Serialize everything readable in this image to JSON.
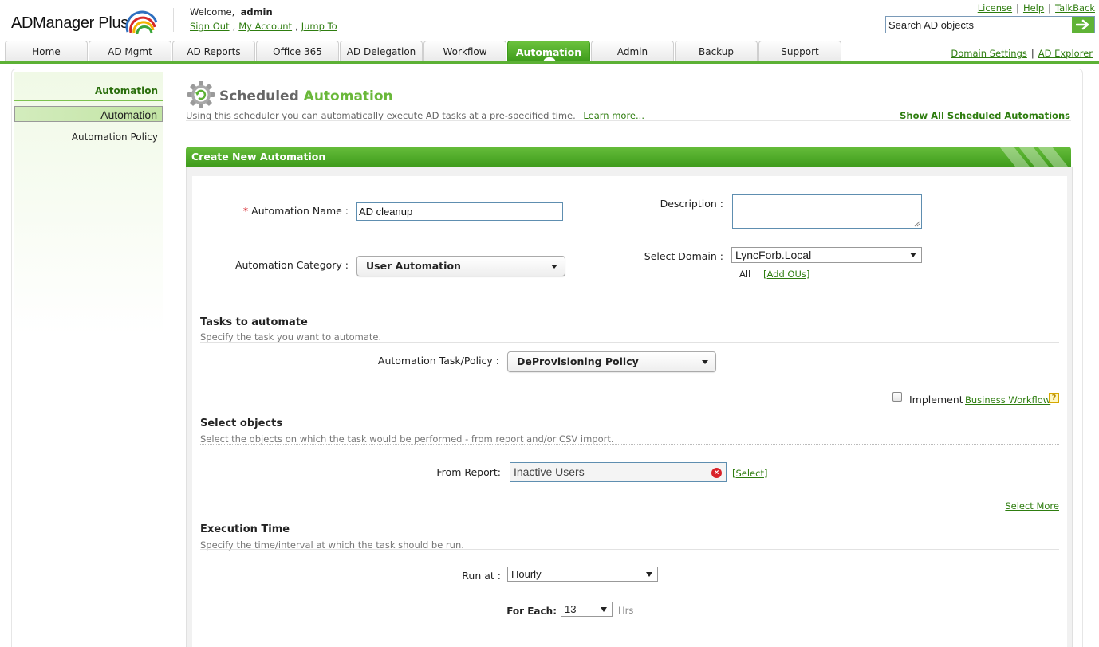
{
  "header": {
    "logo_text_bold": "ADManager",
    "logo_text_light": " Plus",
    "welcome_label": "Welcome,",
    "username": "admin",
    "user_links": [
      "Sign Out",
      "My Account",
      "Jump To"
    ],
    "top_links": [
      "License",
      "Help",
      "TalkBack"
    ],
    "search_placeholder": "Search AD objects"
  },
  "tabs": [
    {
      "label": "Home",
      "active": false
    },
    {
      "label": "AD Mgmt",
      "active": false
    },
    {
      "label": "AD Reports",
      "active": false
    },
    {
      "label": "Office 365",
      "active": false
    },
    {
      "label": "AD Delegation",
      "active": false
    },
    {
      "label": "Workflow",
      "active": false
    },
    {
      "label": "Automation",
      "active": true
    },
    {
      "label": "Admin",
      "active": false
    },
    {
      "label": "Backup",
      "active": false
    },
    {
      "label": "Support",
      "active": false
    }
  ],
  "right_links": [
    "Domain Settings",
    "AD Explorer"
  ],
  "sidebar": {
    "heading": "Automation",
    "items": [
      {
        "label": "Automation",
        "selected": true
      },
      {
        "label": "Automation Policy",
        "selected": false
      }
    ]
  },
  "page": {
    "title_gray": "Scheduled ",
    "title_green": "Automation",
    "subtitle": "Using this scheduler you can automatically execute AD tasks at a pre-specified time.",
    "learn_more": "Learn more...",
    "show_all": "Show All Scheduled Automations",
    "panel_title": "Create New Automation"
  },
  "form": {
    "required_mark": "*",
    "automation_name_label": "Automation Name :",
    "automation_name_value": "AD cleanup",
    "description_label": "Description :",
    "description_value": "",
    "category_label": "Automation Category :",
    "category_value": "User Automation",
    "domain_label": "Select Domain :",
    "domain_value": "LyncForb.Local",
    "ou_scope": "All",
    "add_ous": "[Add OUs]"
  },
  "tasks": {
    "title": "Tasks to automate",
    "desc": "Specify the task you want to automate.",
    "task_label": "Automation Task/Policy :",
    "task_value": "DeProvisioning Policy",
    "implement_label": "Implement",
    "business_workflow": "Business Workflow",
    "help_glyph": "?"
  },
  "objects": {
    "title": "Select objects",
    "desc": "Select the objects on which the task would be performed - from report and/or CSV import.",
    "from_report_label": "From Report:",
    "from_report_value": "Inactive Users",
    "clear_glyph": "×",
    "select_link": "[Select]",
    "select_more": "Select More"
  },
  "execution": {
    "title": "Execution Time",
    "desc": "Specify the time/interval at which the task should be run.",
    "run_at_label": "Run at :",
    "run_at_value": "Hourly",
    "for_each_label": "For Each:",
    "for_each_value": "13",
    "hrs_label": "Hrs"
  },
  "colors": {
    "brand_green": "#5cb135",
    "link_green": "#2e7d0f",
    "required_red": "#d4181f"
  }
}
